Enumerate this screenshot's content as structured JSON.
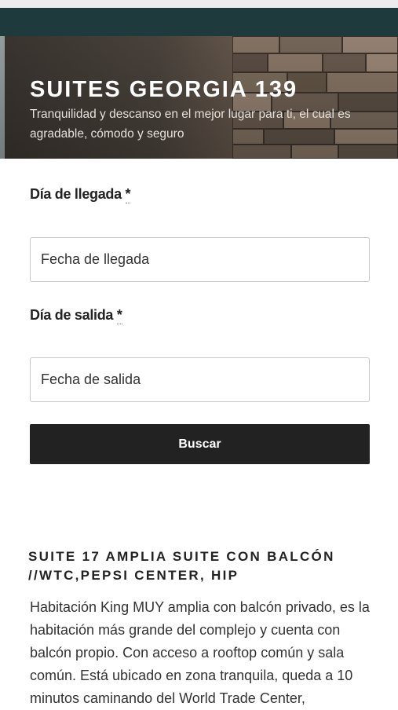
{
  "site": {
    "title": "SUITES GEORGIA 139",
    "tagline": "Tranquilidad y descanso en el mejor lugar para ti, el cual es agradable, cómodo y seguro"
  },
  "form": {
    "arrival_label": "Día de llegada",
    "arrival_required": "*",
    "arrival_placeholder": "Fecha de llegada",
    "departure_label": "Día de salida",
    "departure_required": "*",
    "departure_placeholder": "Fecha de salida",
    "search_button": "Buscar"
  },
  "room": {
    "title": "SUITE 17 AMPLIA SUITE CON BALCÓN //WTC,PEPSI CENTER, HIP",
    "description": "Habitación King MUY amplia con balcón privado, es la habitación más grande del complejo y cuenta con balcón propio. Con acceso a rooftop común y sala común. Está ubicado en zona tranquila, queda a 10 minutos caminando del World Trade Center,"
  },
  "colors": {
    "nav_bar": "#1f3a3c",
    "button": "#222222",
    "text": "#333333"
  }
}
